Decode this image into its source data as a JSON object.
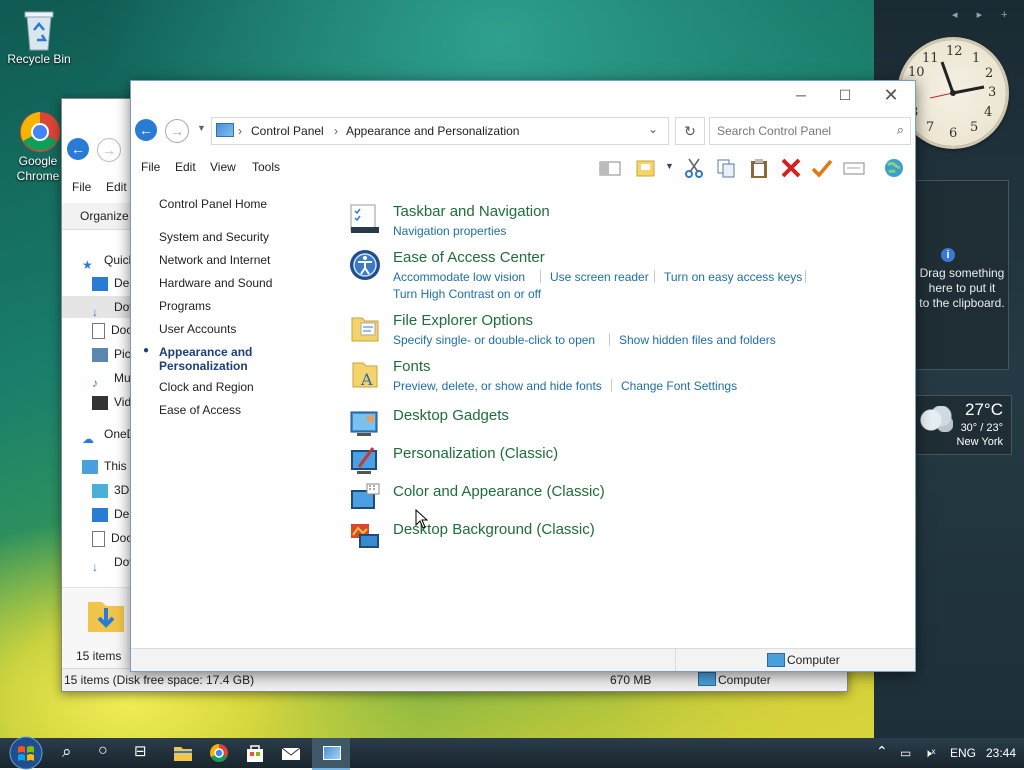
{
  "desktop": {
    "icons": [
      {
        "label": "Recycle Bin"
      },
      {
        "label": "Google Chrome"
      }
    ]
  },
  "gadgets": {
    "clock": {
      "numbers": [
        "12",
        "1",
        "2",
        "3",
        "4",
        "5",
        "6",
        "7",
        "8",
        "9",
        "10",
        "11"
      ]
    },
    "clipboard": {
      "line1": "Drag something",
      "line2": "here to put it",
      "line3": "to the clipboard."
    },
    "weather": {
      "temp": "27°C",
      "range": "30° / 23°",
      "city": "New York"
    }
  },
  "back_window": {
    "menu": [
      "File",
      "Edit"
    ],
    "organize": "Organize",
    "tree": [
      {
        "label": "Quick access"
      },
      {
        "label": "Desktop"
      },
      {
        "label": "Downloads"
      },
      {
        "label": "Documents"
      },
      {
        "label": "Pictures"
      },
      {
        "label": "Music"
      },
      {
        "label": "Videos"
      },
      {
        "label": "OneDrive"
      },
      {
        "label": "This PC"
      },
      {
        "label": "3D Objects"
      },
      {
        "label": "Desktop"
      },
      {
        "label": "Documents"
      },
      {
        "label": "Downloads"
      }
    ],
    "items_count": "15 items",
    "status": "15 items (Disk free space: 17.4 GB)",
    "size": "670 MB",
    "location": "Computer"
  },
  "window": {
    "breadcrumb": [
      "Control Panel",
      "Appearance and Personalization"
    ],
    "search_placeholder": "Search Control Panel",
    "menu": [
      "File",
      "Edit",
      "View",
      "Tools"
    ],
    "left_nav": [
      {
        "label": "Control Panel Home"
      },
      {
        "label": "System and Security"
      },
      {
        "label": "Network and Internet"
      },
      {
        "label": "Hardware and Sound"
      },
      {
        "label": "Programs"
      },
      {
        "label": "User Accounts"
      },
      {
        "label": "Appearance and Personalization",
        "line1": "Appearance and",
        "line2": "Personalization",
        "active": true
      },
      {
        "label": "Clock and Region"
      },
      {
        "label": "Ease of Access"
      }
    ],
    "categories": [
      {
        "title": "Taskbar and Navigation",
        "links": [
          "Navigation properties"
        ]
      },
      {
        "title": "Ease of Access Center",
        "links": [
          "Accommodate low vision",
          "Use screen reader",
          "Turn on easy access keys",
          "Turn High Contrast on or off"
        ]
      },
      {
        "title": "File Explorer Options",
        "links": [
          "Specify single- or double-click to open",
          "Show hidden files and folders"
        ]
      },
      {
        "title": "Fonts",
        "links": [
          "Preview, delete, or show and hide fonts",
          "Change Font Settings"
        ]
      },
      {
        "title": "Desktop Gadgets",
        "links": []
      },
      {
        "title": "Personalization (Classic)",
        "links": []
      },
      {
        "title": "Color and Appearance (Classic)",
        "links": []
      },
      {
        "title": "Desktop Background (Classic)",
        "links": []
      }
    ],
    "status_location": "Computer"
  },
  "taskbar": {
    "lang": "ENG",
    "time": "23:44"
  }
}
